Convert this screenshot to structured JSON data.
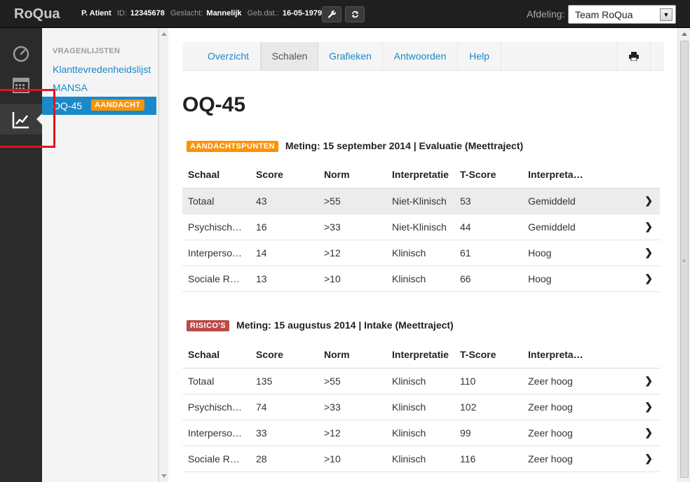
{
  "topbar": {
    "logo": "RoQua",
    "patient_name": "P. Atient",
    "id_label": "ID:",
    "id_value": "12345678",
    "gender_label": "Geslacht:",
    "gender_value": "Mannelijk",
    "dob_label": "Geb.dat.:",
    "dob_value": "16-05-1979",
    "afdeling_label": "Afdeling:",
    "afdeling_value": "Team RoQua"
  },
  "iconbar": {
    "items": [
      "dashboard-icon",
      "calendar-icon",
      "chart-icon"
    ]
  },
  "sidebar": {
    "heading": "VRAGENLIJSTEN",
    "items": [
      {
        "label": "Klanttevredenheidslijst"
      },
      {
        "label": "MANSA"
      },
      {
        "label": "OQ-45",
        "badge": "AANDACHT"
      }
    ]
  },
  "tabs": [
    {
      "label": "Overzicht"
    },
    {
      "label": "Schalen"
    },
    {
      "label": "Grafieken"
    },
    {
      "label": "Antwoorden"
    },
    {
      "label": "Help"
    }
  ],
  "page_title": "OQ-45",
  "sections": [
    {
      "badge": "AANDACHTSPUNTEN",
      "title": "Meting: 15 september 2014 | Evaluatie (Meettraject)",
      "headers": [
        "Schaal",
        "Score",
        "Norm",
        "Interpretatie",
        "T-Score",
        "Interpreta…"
      ],
      "rows": [
        [
          "Totaal",
          "43",
          ">55",
          "Niet-Klinisch",
          "53",
          "Gemiddeld"
        ],
        [
          "Psychisch…",
          "16",
          ">33",
          "Niet-Klinisch",
          "44",
          "Gemiddeld"
        ],
        [
          "Interperso…",
          "14",
          ">12",
          "Klinisch",
          "61",
          "Hoog"
        ],
        [
          "Sociale R…",
          "13",
          ">10",
          "Klinisch",
          "66",
          "Hoog"
        ]
      ]
    },
    {
      "badge": "RISICO'S",
      "title": "Meting: 15 augustus 2014 | Intake (Meettraject)",
      "headers": [
        "Schaal",
        "Score",
        "Norm",
        "Interpretatie",
        "T-Score",
        "Interpreta…"
      ],
      "rows": [
        [
          "Totaal",
          "135",
          ">55",
          "Klinisch",
          "110",
          "Zeer hoog"
        ],
        [
          "Psychisch…",
          "74",
          ">33",
          "Klinisch",
          "102",
          "Zeer hoog"
        ],
        [
          "Interperso…",
          "33",
          ">12",
          "Klinisch",
          "99",
          "Zeer hoog"
        ],
        [
          "Sociale R…",
          "28",
          ">10",
          "Klinisch",
          "116",
          "Zeer hoog"
        ]
      ]
    }
  ],
  "colors": {
    "accent": "#1b88c9",
    "badge_orange": "#f89406",
    "badge_red": "#b94a48",
    "highlight": "#e0141b"
  }
}
